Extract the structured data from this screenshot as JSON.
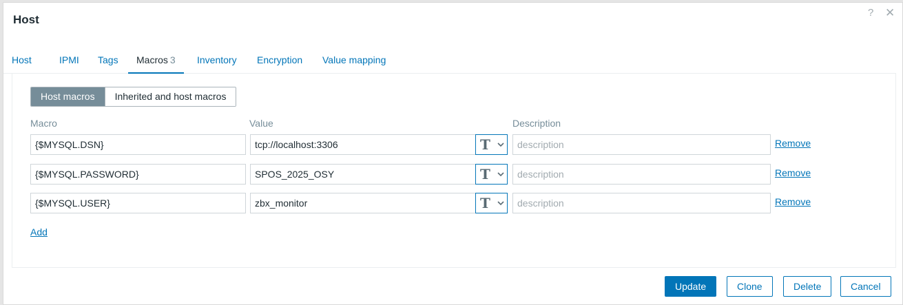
{
  "dialog": {
    "title": "Host",
    "help_glyph": "?",
    "close_glyph": "✕"
  },
  "tabs": [
    {
      "label": "Host"
    },
    {
      "label": "IPMI"
    },
    {
      "label": "Tags"
    },
    {
      "label": "Macros",
      "count": "3",
      "active": true
    },
    {
      "label": "Inventory"
    },
    {
      "label": "Encryption"
    },
    {
      "label": "Value mapping"
    }
  ],
  "macros": {
    "toggle": {
      "host_macros": "Host macros",
      "inherited": "Inherited and host macros"
    },
    "columns": {
      "macro": "Macro",
      "value": "Value",
      "description": "Description"
    },
    "rows": [
      {
        "macro": "{$MYSQL.DSN}",
        "value": "tcp://localhost:3306",
        "type_glyph": "T",
        "description_placeholder": "description",
        "remove": "Remove"
      },
      {
        "macro": "{$MYSQL.PASSWORD}",
        "value": "SPOS_2025_OSY",
        "type_glyph": "T",
        "description_placeholder": "description",
        "remove": "Remove"
      },
      {
        "macro": "{$MYSQL.USER}",
        "value": "zbx_monitor",
        "type_glyph": "T",
        "description_placeholder": "description",
        "remove": "Remove"
      }
    ],
    "add": "Add"
  },
  "footer": {
    "update": "Update",
    "clone": "Clone",
    "delete": "Delete",
    "cancel": "Cancel"
  },
  "colors": {
    "accent": "#0275b8",
    "muted": "#768d99",
    "text": "#1f2c33"
  }
}
